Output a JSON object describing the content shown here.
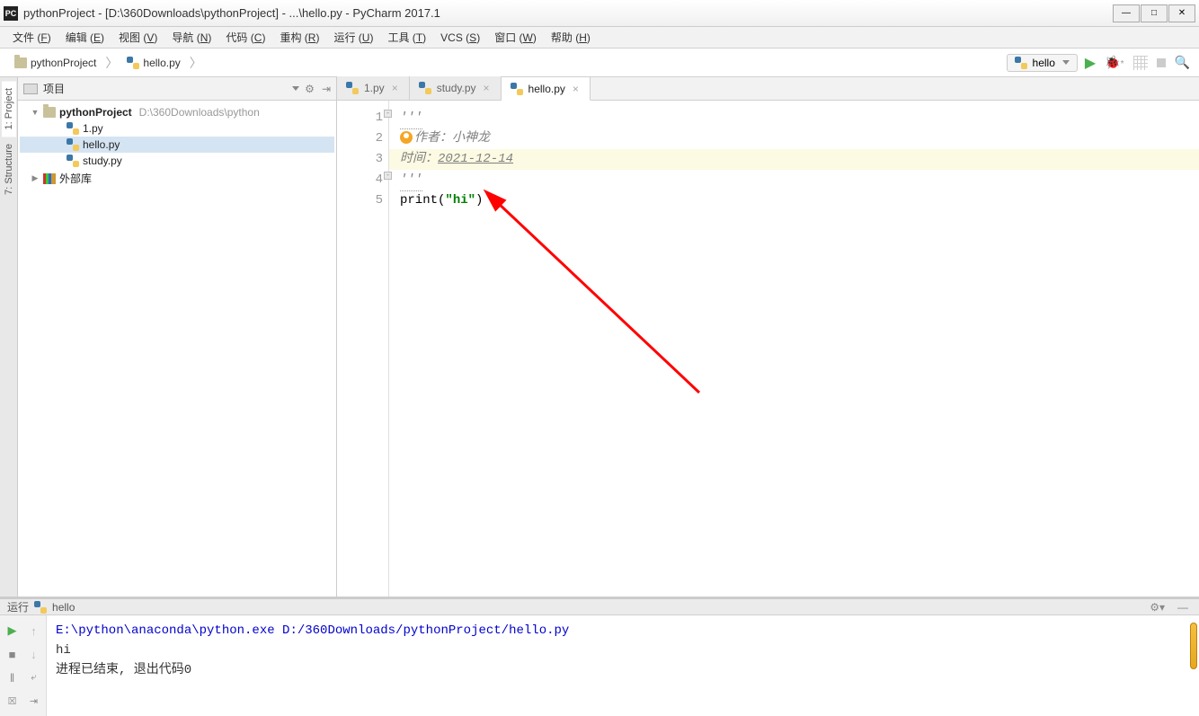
{
  "titlebar": {
    "title": "pythonProject - [D:\\360Downloads\\pythonProject] - ...\\hello.py - PyCharm 2017.1"
  },
  "menubar": {
    "items": [
      {
        "label": "文件",
        "key": "F"
      },
      {
        "label": "编辑",
        "key": "E"
      },
      {
        "label": "视图",
        "key": "V"
      },
      {
        "label": "导航",
        "key": "N"
      },
      {
        "label": "代码",
        "key": "C"
      },
      {
        "label": "重构",
        "key": "R"
      },
      {
        "label": "运行",
        "key": "U"
      },
      {
        "label": "工具",
        "key": "T"
      },
      {
        "label": "VCS",
        "key": "S"
      },
      {
        "label": "窗口",
        "key": "W"
      },
      {
        "label": "帮助",
        "key": "H"
      }
    ]
  },
  "breadcrumb": {
    "items": [
      {
        "icon": "folder",
        "label": "pythonProject"
      },
      {
        "icon": "py",
        "label": "hello.py"
      }
    ]
  },
  "run_config": {
    "selected": "hello"
  },
  "left_tabs": {
    "items": [
      {
        "label": "1: Project",
        "name": "project"
      },
      {
        "label": "7: Structure",
        "name": "structure"
      }
    ]
  },
  "project_panel": {
    "title": "项目",
    "tree": [
      {
        "depth": 0,
        "arrow": "▼",
        "icon": "folder",
        "label": "pythonProject",
        "bold": true,
        "path": "D:\\360Downloads\\python"
      },
      {
        "depth": 1,
        "arrow": "",
        "icon": "py",
        "label": "1.py"
      },
      {
        "depth": 1,
        "arrow": "",
        "icon": "py",
        "label": "hello.py",
        "selected": true
      },
      {
        "depth": 1,
        "arrow": "",
        "icon": "py",
        "label": "study.py"
      },
      {
        "depth": 0,
        "arrow": "▶",
        "icon": "libs",
        "label": "外部库"
      }
    ]
  },
  "editor_tabs": {
    "items": [
      {
        "label": "1.py",
        "active": false
      },
      {
        "label": "study.py",
        "active": false
      },
      {
        "label": "hello.py",
        "active": true
      }
    ]
  },
  "code": {
    "lines": [
      {
        "n": "1",
        "html": "<span class='c-comment squiggle'>'''</span>"
      },
      {
        "n": "2",
        "html": "<span class='person-ico'></span><span class='c-comment'>作者：小神龙</span>"
      },
      {
        "n": "3",
        "hl": true,
        "html": "<span class='c-comment'>时间：</span><span class='c-date'>2021-12-14</span>"
      },
      {
        "n": "4",
        "html": "<span class='c-comment squiggle'>'''</span>"
      },
      {
        "n": "5",
        "html": "<span>print</span>(<span class='c-str'>\"hi\"</span>)"
      }
    ]
  },
  "run_panel": {
    "label": "运行",
    "config": "hello",
    "console": [
      {
        "type": "path",
        "text": "E:\\python\\anaconda\\python.exe D:/360Downloads/pythonProject/hello.py"
      },
      {
        "type": "out",
        "text": "hi"
      },
      {
        "type": "blank",
        "text": ""
      },
      {
        "type": "out",
        "text": "进程已结束, 退出代码0"
      }
    ]
  }
}
